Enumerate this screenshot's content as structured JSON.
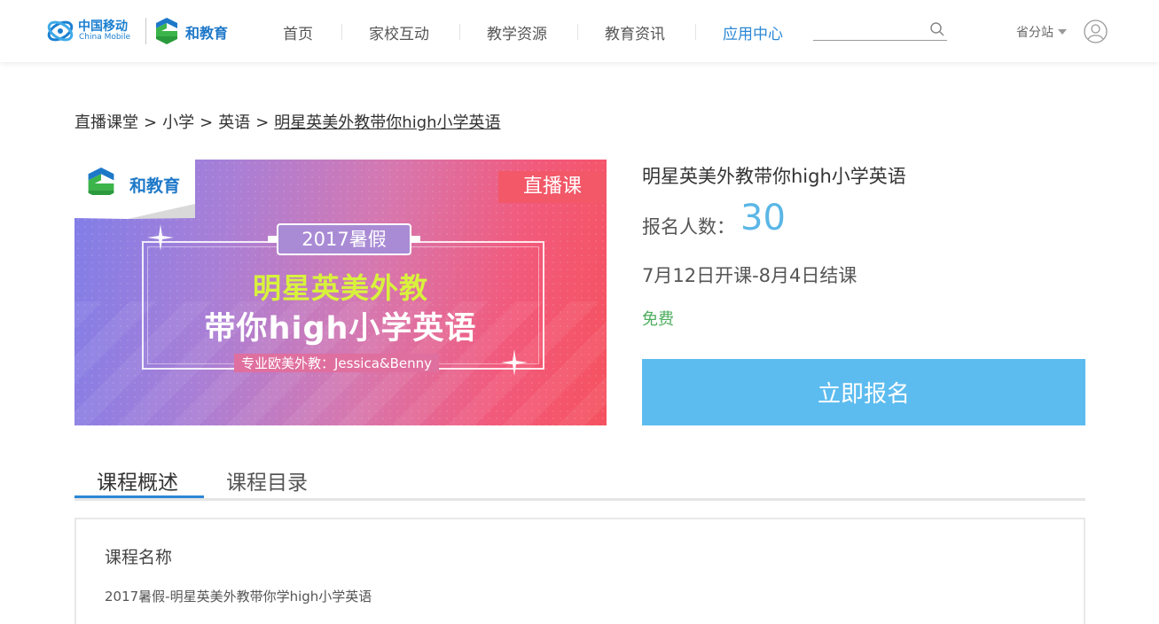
{
  "header": {
    "cm_logo_cn": "中国移动",
    "cm_logo_en": "China Mobile",
    "he_logo": "和教育",
    "nav": [
      {
        "label": "首页",
        "active": false
      },
      {
        "label": "家校互动",
        "active": false
      },
      {
        "label": "教学资源",
        "active": false
      },
      {
        "label": "教育资讯",
        "active": false
      },
      {
        "label": "应用中心",
        "active": true
      }
    ],
    "search": {
      "placeholder": "",
      "value": "",
      "icon": "search-icon"
    },
    "region": "省分站",
    "user_icon": "user-icon"
  },
  "breadcrumb": [
    "直播课堂",
    "小学",
    "英语",
    "明星英美外教带你high小学英语"
  ],
  "banner": {
    "logo": "和教育",
    "tag": "直播课",
    "year": "2017暑假",
    "headline1": "明星英美外教",
    "headline2": "带你high小学英语",
    "teacher": "专业欧美外教：Jessica&Benny"
  },
  "course": {
    "title": "明星英美外教带你high小学英语",
    "count_label": "报名人数：",
    "count": "30",
    "dates": "7月12日开课-8月4日结课",
    "price": "免费",
    "enroll": "立即报名"
  },
  "tabs": [
    {
      "label": "课程概述",
      "active": true
    },
    {
      "label": "课程目录",
      "active": false
    }
  ],
  "content": {
    "section_title": "课程名称",
    "section_text": "2017暑假-明星英美外教带你学high小学英语"
  },
  "colors": {
    "accent": "#2b87d6",
    "button": "#5dbcef",
    "count": "#5bb6e6",
    "price": "#4fae5f",
    "live_tag": "#f25868"
  }
}
